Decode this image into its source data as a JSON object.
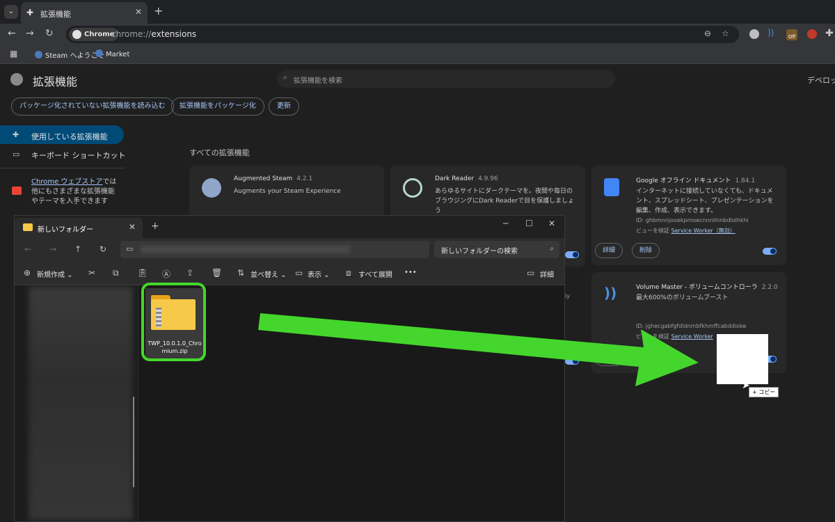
{
  "browser": {
    "tab_title": "拡張機能",
    "chip_label": "Chrome",
    "url_scheme": "chrome://",
    "url_path": "extensions",
    "bookmarks": [
      "Steam へようこそ",
      "Market"
    ],
    "ext_badge": "Off"
  },
  "page": {
    "title": "拡張機能",
    "search_placeholder": "拡張機能を検索",
    "dev_mode": "デベロッパー",
    "buttons": [
      "パッケージ化されていない拡張機能を読み込む",
      "拡張機能をパッケージ化",
      "更新"
    ],
    "sidebar": {
      "active": "使用している拡張機能",
      "shortcuts": "キーボード ショートカット",
      "store_link": "Chrome ウェブストア",
      "store_suffix": "では他にもさまざまな拡張機能やテーマを入手できます"
    },
    "section_title": "すべての拡張機能"
  },
  "extensions": [
    {
      "name": "Augmented Steam",
      "version": "4.2.1",
      "desc": "Augments your Steam Experience",
      "color": "#8fa6c9"
    },
    {
      "name": "Dark Reader",
      "version": "4.9.96",
      "desc": "あらゆるサイトにダークテーマを。夜間や毎日のブラウジングにDark Readerで目を保護しましょう",
      "color": "#3c6e71"
    },
    {
      "name": "Google オフライン ドキュメント",
      "version": "1.84.1",
      "desc": "インターネットに接続していなくても、ドキュメント、スプレッドシート、プレゼンテーションを編集、作成、表示できます。",
      "id": "ID: ghbmnnjooekpmoecnnnilnnbdlolhkhi",
      "inspect": "ビューを検証",
      "inspect_link": "Service Worker（無効）",
      "btn_details": "詳細",
      "btn_remove": "削除",
      "color": "#4285f4"
    },
    {
      "name": "Volume Master - ボリュームコントローラ",
      "version": "2.2.0",
      "desc": "最大600%のボリュームブースト",
      "id": "ID: jghecgabfgfdldnmbfkhmffcabddioke",
      "inspect": "ビューを検証",
      "inspect_link": "Service Worker",
      "btn_details": "詳細",
      "color": "#1a73e8"
    }
  ],
  "extra_card_text": "ly",
  "explorer": {
    "tab_title": "新しいフォルダー",
    "search_placeholder": "新しいフォルダーの検索",
    "commands": {
      "new": "新規作成",
      "sort": "並べ替え",
      "view": "表示",
      "expand_all": "すべて展開",
      "more": "•••",
      "details": "詳細"
    },
    "file_name": "TWP_10.0.1.0_Chromium.zip"
  },
  "drag": {
    "copy_label": "+ コピー"
  },
  "colors": {
    "arrow": "#44d62c",
    "accent": "#a8c7fa"
  }
}
